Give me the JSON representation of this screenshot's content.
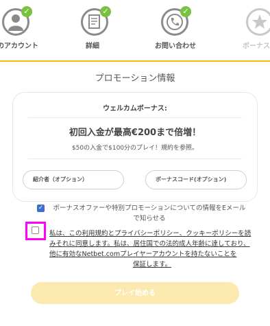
{
  "steps": [
    {
      "label": "のアカウント",
      "icon": "user-icon",
      "completed": true
    },
    {
      "label": "詳細",
      "icon": "document-icon",
      "completed": true
    },
    {
      "label": "お問い合わせ",
      "icon": "phone-icon",
      "completed": true
    },
    {
      "label": "ボーナス",
      "icon": "star-icon",
      "completed": false
    }
  ],
  "section_title": "プロモーション情報",
  "card": {
    "welcome_label": "ウェルカムボーナス:",
    "offer_title": "初回入金が最高€200まで倍増！",
    "offer_subtitle": "$50の入金で$100分のプレイ！規約を参照。"
  },
  "inputs": {
    "referrer_placeholder": "紹介者（オプション）",
    "bonus_code_placeholder": "ボーナスコード(オプション)"
  },
  "marketing_checkbox": {
    "checked": true,
    "text": "ボーナスオファーや特別プロモーションについての情報をEメールで知らせる"
  },
  "terms_checkbox": {
    "checked": false,
    "text_main": "私は、この利用規約とプライバシーポリシー、クッキーポリシーを読みそれに同意します。私は、居住国での法的成人年齢に達しており、他に有効なNetbet.comプレイヤーアカウントを持たないことを",
    "text_last": "保証します。"
  },
  "play_button": "プレイ始める",
  "colors": {
    "accent_line": "#f2c200",
    "check_green": "#7ac142",
    "button_disabled": "#fbe9b0",
    "highlight": "#ff00ff"
  }
}
